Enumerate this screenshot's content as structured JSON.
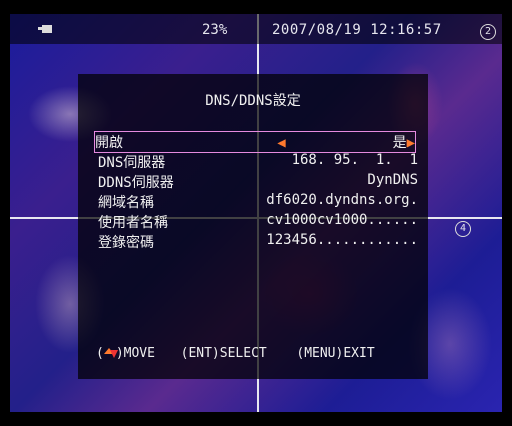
{
  "status_bar": {
    "percent": "23%",
    "datetime": "2007/08/19 12:16:57",
    "camera_icon": "camera-icon"
  },
  "markers": {
    "top_right": "2",
    "bottom_right": "4"
  },
  "menu": {
    "title": "DNS/DDNS設定",
    "rows": [
      {
        "label": "開啟",
        "value": "是",
        "left_arrow": "◀",
        "right_arrow": "▶"
      },
      {
        "label": "DNS伺服器",
        "value": "168. 95.  1.  1"
      },
      {
        "label": "DDNS伺服器",
        "value": "DynDNS"
      },
      {
        "label": "網域名稱",
        "value": "df6020.dyndns.org."
      },
      {
        "label": "使用者名稱",
        "value": "cv1000cv1000......"
      },
      {
        "label": "登錄密碼",
        "value": "123456............"
      }
    ],
    "footer": {
      "move": ")MOVE",
      "move_open": "(",
      "select": "(ENT)SELECT",
      "exit": "(MENU)EXIT"
    }
  }
}
